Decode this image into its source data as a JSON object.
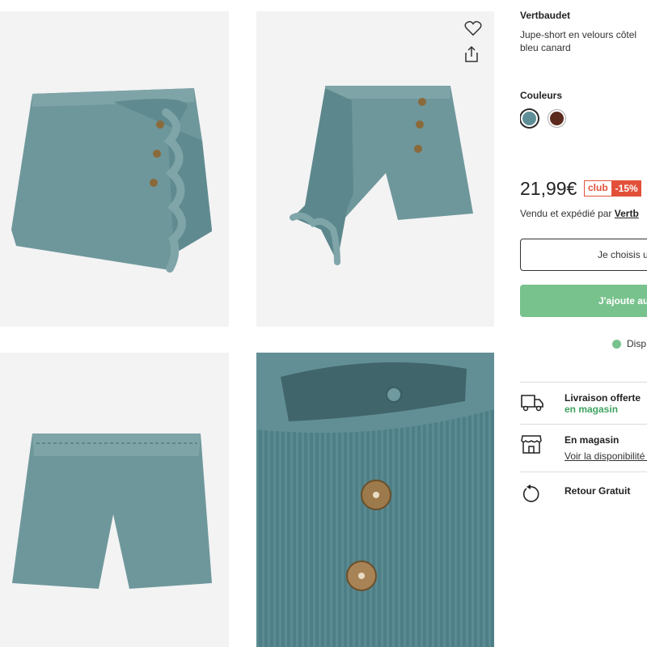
{
  "brand": "Vertbaudet",
  "product": {
    "title_line1": "Jupe-short en velours côtel",
    "title_line2": "bleu canard"
  },
  "colors": {
    "label": "Couleurs",
    "options": [
      {
        "name": "blue-teal",
        "hex": "#5f8f96",
        "selected": true
      },
      {
        "name": "brown",
        "hex": "#5c2a1c",
        "selected": false
      }
    ]
  },
  "price": {
    "amount": "21,99€",
    "club_label": "club",
    "discount": "-15%"
  },
  "seller": {
    "prefix": "Vendu et expédié par",
    "name": "Vertb"
  },
  "buttons": {
    "choose_size": "Je choisis u",
    "add_to_cart": "J'ajoute au"
  },
  "availability": "Disp",
  "services": [
    {
      "icon": "delivery-truck-icon",
      "title": "Livraison offerte",
      "subtitle": "en magasin"
    },
    {
      "icon": "store-icon",
      "title": "En magasin",
      "subtitle": "Voir la disponibilité d"
    },
    {
      "icon": "return-arrow-icon",
      "title": "Retour Gratuit"
    }
  ],
  "accent_colors": {
    "garment": "#5f8f96",
    "club_red": "#e2503a",
    "cta_green": "#78c28d"
  }
}
